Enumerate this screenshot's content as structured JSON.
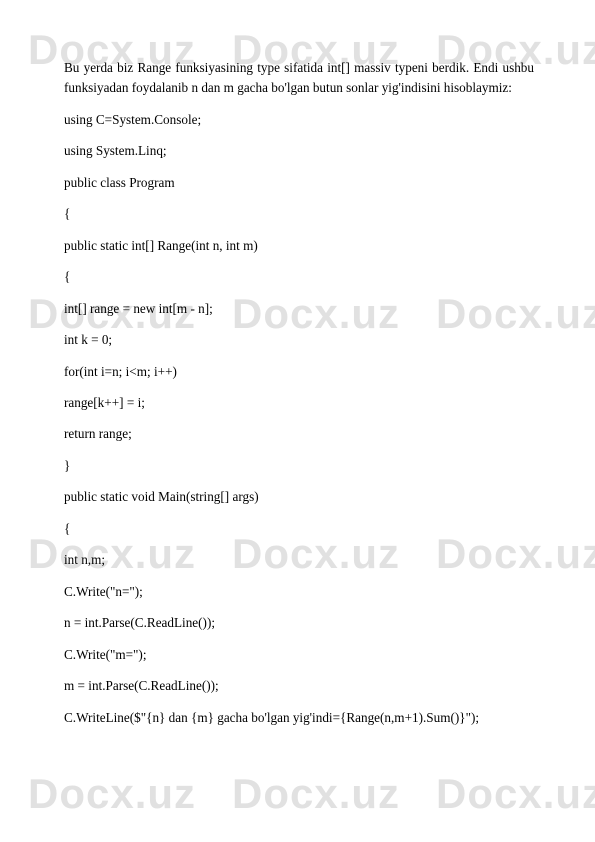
{
  "watermark": "Docx.uz",
  "intro": "Bu yerda biz Range funksiyasining type sifatida int[] massiv typeni berdik. Endi ushbu funksiyadan foydalanib n dan m gacha bo'lgan butun sonlar yig'indisini hisoblaymiz:",
  "lines": [
    "using C=System.Console;",
    "using System.Linq;",
    "public class Program",
    "{",
    "public static int[] Range(int n, int m)",
    "{",
    "int[] range = new int[m - n];",
    "int k = 0;",
    "for(int i=n; i<m; i++)",
    "range[k++] = i;",
    "return range;",
    "}",
    "public static void Main(string[] args)",
    "{",
    "int n,m;",
    "C.Write(\"n=\");",
    "n = int.Parse(C.ReadLine());",
    "C.Write(\"m=\");",
    "m = int.Parse(C.ReadLine());",
    "C.WriteLine($\"{n} dan {m} gacha bo'lgan yig'indi={Range(n,m+1).Sum()}\");"
  ]
}
